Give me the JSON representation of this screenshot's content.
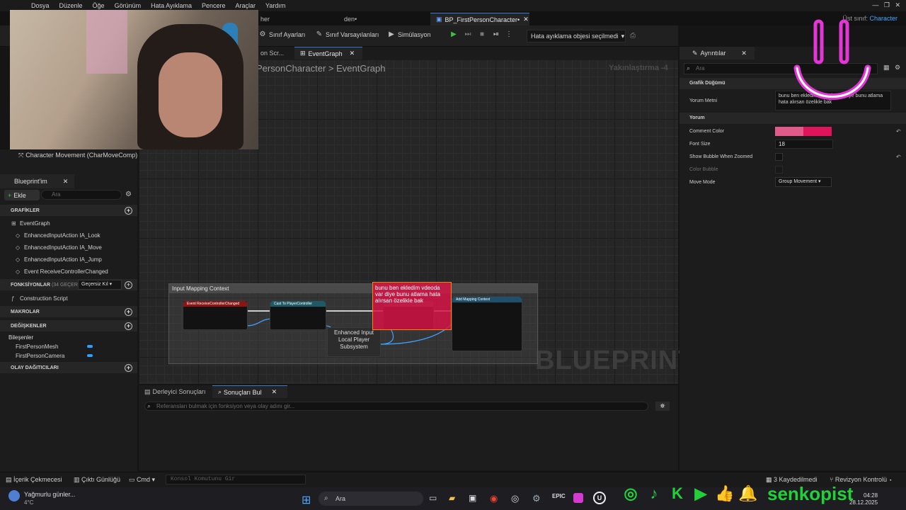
{
  "menu": [
    "Dosya",
    "Düzenle",
    "Öğe",
    "Görünüm",
    "Hata Ayıklama",
    "Pencere",
    "Araçlar",
    "Yardım"
  ],
  "tabs": [
    {
      "label": "her"
    },
    {
      "label": "den•"
    },
    {
      "label": "BP_FirstPersonCharacter•"
    }
  ],
  "parent_class": {
    "label": "Üst sınıf:",
    "value": "Character"
  },
  "toolbar": {
    "class_settings": "Sınıf Ayarları",
    "class_defaults": "Sınıf Varsayılanları",
    "simulation": "Simülasyon",
    "debug_object": "Hata ayıklama objesi seçilmedi"
  },
  "graph_tabs": {
    "construction": "on Scr...",
    "event_graph": "EventGraph"
  },
  "breadcrumb": {
    "parent": "PersonCharacter",
    "separator": ">",
    "current": "EventGraph"
  },
  "zoom": "Yakınlaştırma -4",
  "watermark": "BLUEPRINT",
  "comment_box": "Input Mapping Context",
  "nodes": {
    "event_controller_changed": "Event ReceiveControllerChanged",
    "cast_player_controller": "Cast To PlayerController",
    "enhanced_input_subsystem": "Enhanced Input Local Player Subsystem",
    "add_mapping_context": "Add Mapping Context"
  },
  "pink_comment": "bunu ben ekledim vdeoda var diye bunu atlama hata alırsan özelikle bak",
  "components": {
    "char_movement": "Character Movement (CharMoveComp)"
  },
  "my_blueprint": {
    "tab": "Blueprint'im",
    "add": "Ekle",
    "search_placeholder": "Ara",
    "graphs_header": "GRAFİKLER",
    "graphs": [
      "EventGraph",
      "EnhancedInputAction IA_Look",
      "EnhancedInputAction IA_Move",
      "EnhancedInputAction IA_Jump",
      "Event ReceiveControllerChanged"
    ],
    "functions_header": "FONKSİYONLAR",
    "functions_count": "(34 GEÇERSİ",
    "override": "Geçersiz Kıl",
    "construction_script": "Construction Script",
    "macros_header": "MAKROLAR",
    "variables_header": "DEĞİŞKENLER",
    "components_header": "Bileşenler",
    "components": [
      "FirstPersonMesh",
      "FirstPersonCamera"
    ],
    "dispatchers_header": "OLAY DAĞITICILARI"
  },
  "details": {
    "tab": "Ayrıntılar",
    "search_placeholder": "Ara",
    "graph_node_section": "Grafik Düğümü",
    "comment_text_label": "Yorum Metni",
    "comment_text_value": "bunu ben ekledim vdeoda var diye bunu atlama hata alırsan özelikle bak",
    "comment_section": "Yorum",
    "props": [
      {
        "label": "Comment Color"
      },
      {
        "label": "Font Size",
        "value": "18"
      },
      {
        "label": "Show Bubble When Zoomed"
      },
      {
        "label": "Color Bubble"
      },
      {
        "label": "Move Mode",
        "value": "Group Movement"
      }
    ]
  },
  "bottom": {
    "compiler_tab": "Derleyici Sonuçları",
    "find_tab": "Sonuçları Bul",
    "search_placeholder": "Referansları bulmak için fonksiyon veya olay adını gir..."
  },
  "statusbar": {
    "content_drawer": "İçerik Çekmecesi",
    "output_log": "Çıktı Günlüğü",
    "cmd": "Cmd",
    "console_placeholder": "Konsol Komutunu Gir",
    "saved": "3 Kaydedilmedi",
    "revision": "Revizyon Kontrolü"
  },
  "taskbar": {
    "weather_text": "Yağmurlu günler...",
    "temperature": "4°C",
    "search": "Ara",
    "time": "04:28",
    "date": "28.12.2025"
  },
  "branding": {
    "name": "senkopist"
  },
  "colors": {
    "accent": "#3a7bd5",
    "comment_pink": "#e0145a",
    "brand_green": "#22d13a",
    "magenta": "#e436d6"
  }
}
